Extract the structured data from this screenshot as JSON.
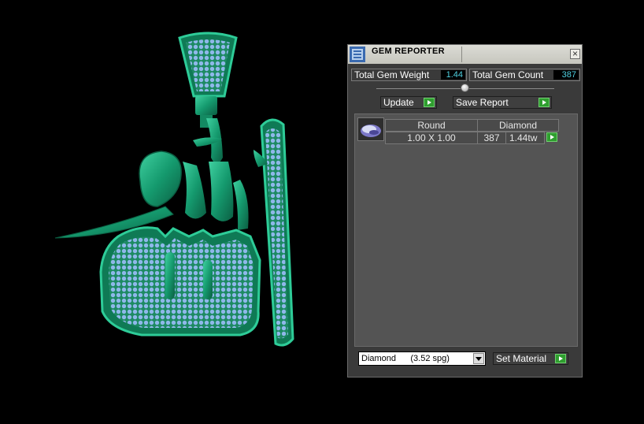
{
  "window": {
    "title": "GEM REPORTER",
    "close_glyph": "×"
  },
  "stats": {
    "weight_label": "Total Gem Weight",
    "weight_value": "1.44",
    "count_label": "Total Gem Count",
    "count_value": "387"
  },
  "buttons": {
    "update": "Update",
    "save_report": "Save Report",
    "set_material": "Set Material"
  },
  "gem_list": {
    "rows": [
      {
        "shape": "Round",
        "material": "Diamond",
        "size": "1.00 X 1.00",
        "count": "387",
        "weight": "1.44tw"
      }
    ]
  },
  "material_select": {
    "value": "Diamond      (3.52 spg)"
  },
  "colors": {
    "accent_green": "#2f9e2f",
    "value_text": "#4fd0e0",
    "pendant_metal": "#1fa37a",
    "gem_blue": "#8fb8ea"
  },
  "icons": [
    "gem-reporter-app-icon",
    "close-icon",
    "slider-knob",
    "round-gem-icon",
    "arrow-right-icon",
    "dropdown-arrow-icon"
  ]
}
